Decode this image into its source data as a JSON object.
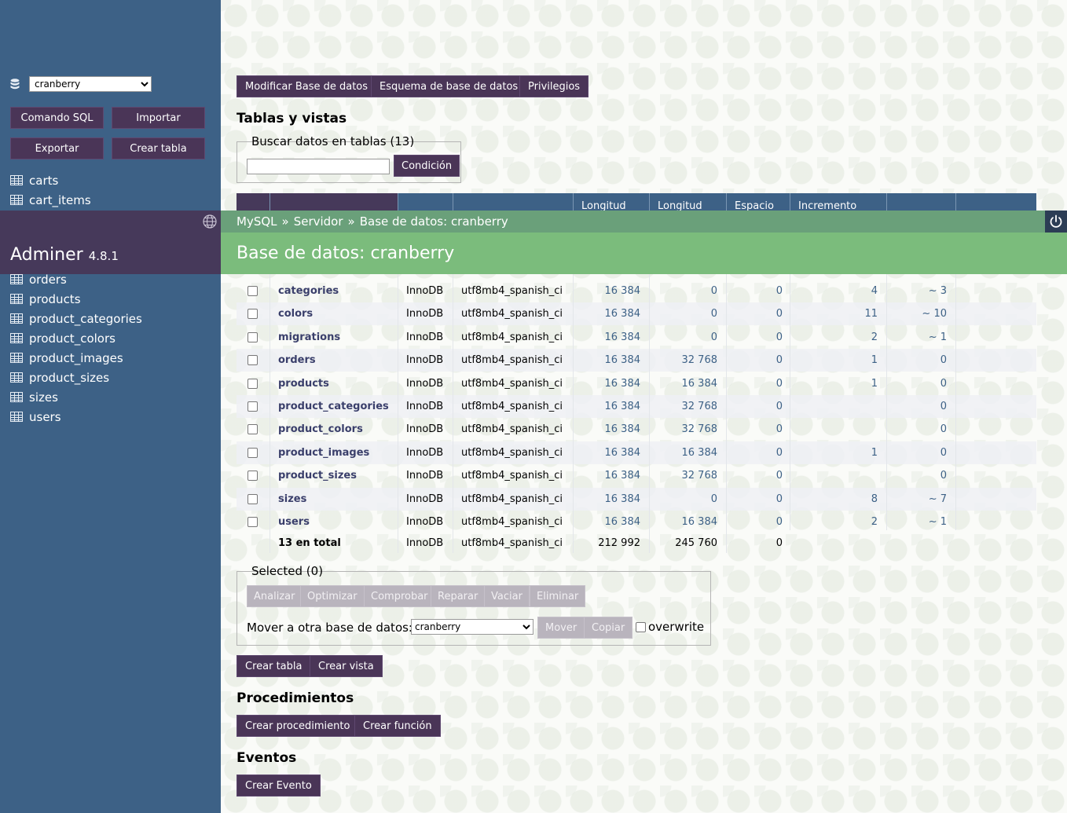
{
  "sidebar": {
    "db_select": "cranberry",
    "buttons": [
      "Comando SQL",
      "Importar",
      "Exportar",
      "Crear tabla"
    ],
    "tables_top": [
      "carts",
      "cart_items"
    ],
    "tables": [
      "orders",
      "products",
      "product_categories",
      "product_colors",
      "product_images",
      "product_sizes",
      "sizes",
      "users"
    ]
  },
  "brand": {
    "name": "Adminer",
    "version": "4.8.1"
  },
  "breadcrumb": {
    "items": [
      "MySQL",
      "Servidor",
      "Base de datos: cranberry"
    ],
    "separator": "»"
  },
  "title": "Base de datos: cranberry",
  "top_buttons": [
    "Modificar Base de datos",
    "Esquema de base de datos",
    "Privilegios"
  ],
  "tables_section": {
    "heading": "Tablas y vistas",
    "search_legend": "Buscar datos en tablas (13)",
    "search_button": "Condición",
    "columns": [
      "Longitud",
      "Longitud",
      "Espacio",
      "Incremento"
    ]
  },
  "rows": [
    {
      "name": "categories",
      "engine": "InnoDB",
      "collation": "utf8mb4_spanish_ci",
      "data": "16 384",
      "index": "0",
      "free": "0",
      "auto": "4",
      "rows": "~ 3"
    },
    {
      "name": "colors",
      "engine": "InnoDB",
      "collation": "utf8mb4_spanish_ci",
      "data": "16 384",
      "index": "0",
      "free": "0",
      "auto": "11",
      "rows": "~ 10"
    },
    {
      "name": "migrations",
      "engine": "InnoDB",
      "collation": "utf8mb4_spanish_ci",
      "data": "16 384",
      "index": "0",
      "free": "0",
      "auto": "2",
      "rows": "~ 1"
    },
    {
      "name": "orders",
      "engine": "InnoDB",
      "collation": "utf8mb4_spanish_ci",
      "data": "16 384",
      "index": "32 768",
      "free": "0",
      "auto": "1",
      "rows": "0"
    },
    {
      "name": "products",
      "engine": "InnoDB",
      "collation": "utf8mb4_spanish_ci",
      "data": "16 384",
      "index": "16 384",
      "free": "0",
      "auto": "1",
      "rows": "0"
    },
    {
      "name": "product_categories",
      "engine": "InnoDB",
      "collation": "utf8mb4_spanish_ci",
      "data": "16 384",
      "index": "32 768",
      "free": "0",
      "auto": "",
      "rows": "0"
    },
    {
      "name": "product_colors",
      "engine": "InnoDB",
      "collation": "utf8mb4_spanish_ci",
      "data": "16 384",
      "index": "32 768",
      "free": "0",
      "auto": "",
      "rows": "0"
    },
    {
      "name": "product_images",
      "engine": "InnoDB",
      "collation": "utf8mb4_spanish_ci",
      "data": "16 384",
      "index": "16 384",
      "free": "0",
      "auto": "1",
      "rows": "0"
    },
    {
      "name": "product_sizes",
      "engine": "InnoDB",
      "collation": "utf8mb4_spanish_ci",
      "data": "16 384",
      "index": "32 768",
      "free": "0",
      "auto": "",
      "rows": "0"
    },
    {
      "name": "sizes",
      "engine": "InnoDB",
      "collation": "utf8mb4_spanish_ci",
      "data": "16 384",
      "index": "0",
      "free": "0",
      "auto": "8",
      "rows": "~ 7"
    },
    {
      "name": "users",
      "engine": "InnoDB",
      "collation": "utf8mb4_spanish_ci",
      "data": "16 384",
      "index": "16 384",
      "free": "0",
      "auto": "2",
      "rows": "~ 1"
    }
  ],
  "total": {
    "name": "13 en total",
    "engine": "InnoDB",
    "collation": "utf8mb4_spanish_ci",
    "data": "212 992",
    "index": "245 760",
    "free": "0"
  },
  "selected": {
    "legend": "Selected (0)",
    "buttons": [
      "Analizar",
      "Optimizar",
      "Comprobar",
      "Reparar",
      "Vaciar",
      "Eliminar"
    ],
    "move_label": "Mover a otra base de datos:",
    "move_select": "cranberry",
    "move_button": "Mover",
    "copy_button": "Copiar",
    "overwrite_label": "overwrite"
  },
  "create_buttons": [
    "Crear tabla",
    "Crear vista"
  ],
  "procedures": {
    "heading": "Procedimientos",
    "buttons": [
      "Crear procedimiento",
      "Crear función"
    ]
  },
  "events": {
    "heading": "Eventos",
    "button": "Crear Evento"
  },
  "colors": {
    "sidebar": "#3d6186",
    "button": "#4a3557",
    "breadcrumb": "#6aa07a",
    "title_bar": "#7bbc7c",
    "link": "#3d6186"
  }
}
